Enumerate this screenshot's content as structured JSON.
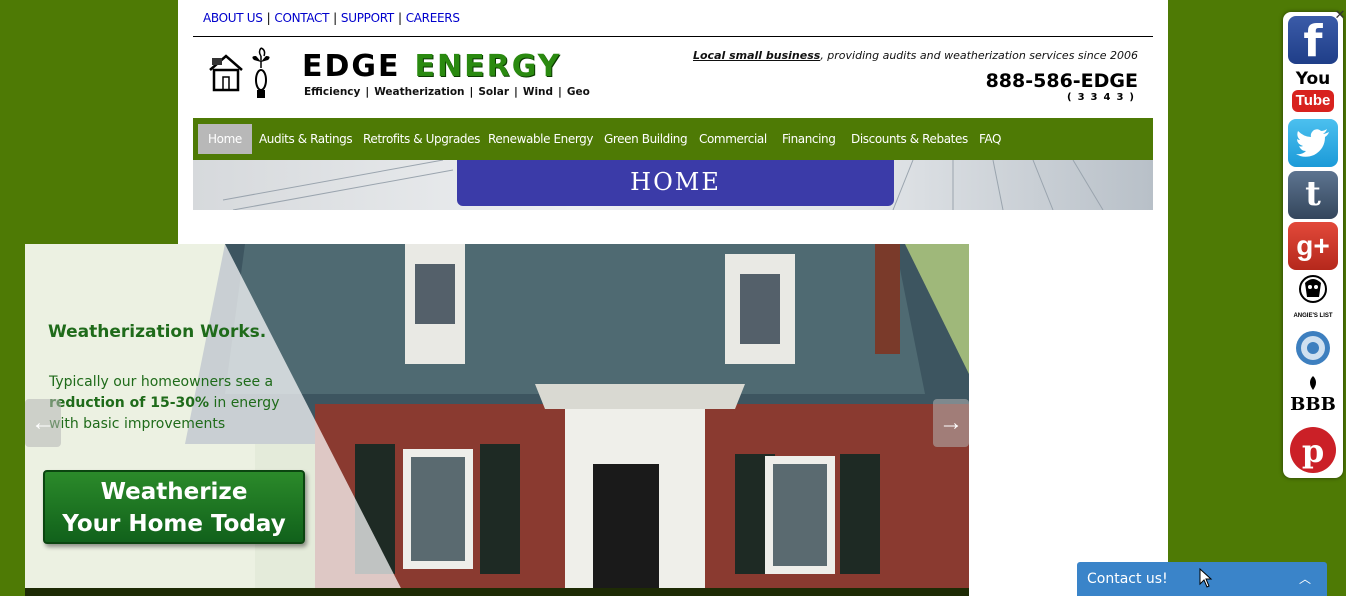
{
  "top_links": [
    "ABOUT US",
    "CONTACT",
    "SUPPORT",
    "CAREERS"
  ],
  "brand": {
    "word1": "EDGE",
    "word2": "ENERGY",
    "services": [
      "Efficiency",
      "Weatherization",
      "Solar",
      "Wind",
      "Geo"
    ]
  },
  "tagline": {
    "bold": "Local small business",
    "rest": ", providing audits and weatherization services since 2006"
  },
  "phone": "888-586-EDGE",
  "phone_digits": "(3343)",
  "nav": [
    {
      "label": "Home",
      "active": true
    },
    {
      "label": "Audits & Ratings",
      "active": false
    },
    {
      "label": "Retrofits & Upgrades",
      "active": false
    },
    {
      "label": "Renewable Energy",
      "active": false
    },
    {
      "label": "Green Building",
      "active": false
    },
    {
      "label": "Commercial",
      "active": false
    },
    {
      "label": "Financing",
      "active": false
    },
    {
      "label": "Discounts & Rebates",
      "active": false
    },
    {
      "label": "FAQ",
      "active": false
    }
  ],
  "banner": {
    "title": "HOME"
  },
  "slide": {
    "heading": "Weatherization Works.",
    "body_pre": "Typically our homeowners see a ",
    "body_bold": "reduction of 15-30%",
    "body_post": " in energy with basic improvements",
    "cta_line1": "Weatherize",
    "cta_line2": "Your Home Today"
  },
  "social": {
    "facebook": "f",
    "youtube_top": "You",
    "youtube_bottom": "Tube",
    "twitter_icon": "twitter-bird-icon",
    "tumblr": "t",
    "googleplus": "g+",
    "angies_list": "ANGIE'S LIST",
    "bbb": "BBB",
    "pinterest_icon": "pinterest-icon"
  },
  "contact_bar": {
    "label": "Contact us!",
    "chevron": "︿"
  },
  "colors": {
    "site_green": "#4e7a05",
    "brand_green": "#2a8a10",
    "banner_blue": "#3b3ba8",
    "contact_blue": "#3a84c9",
    "link_blue": "#0000cc"
  }
}
